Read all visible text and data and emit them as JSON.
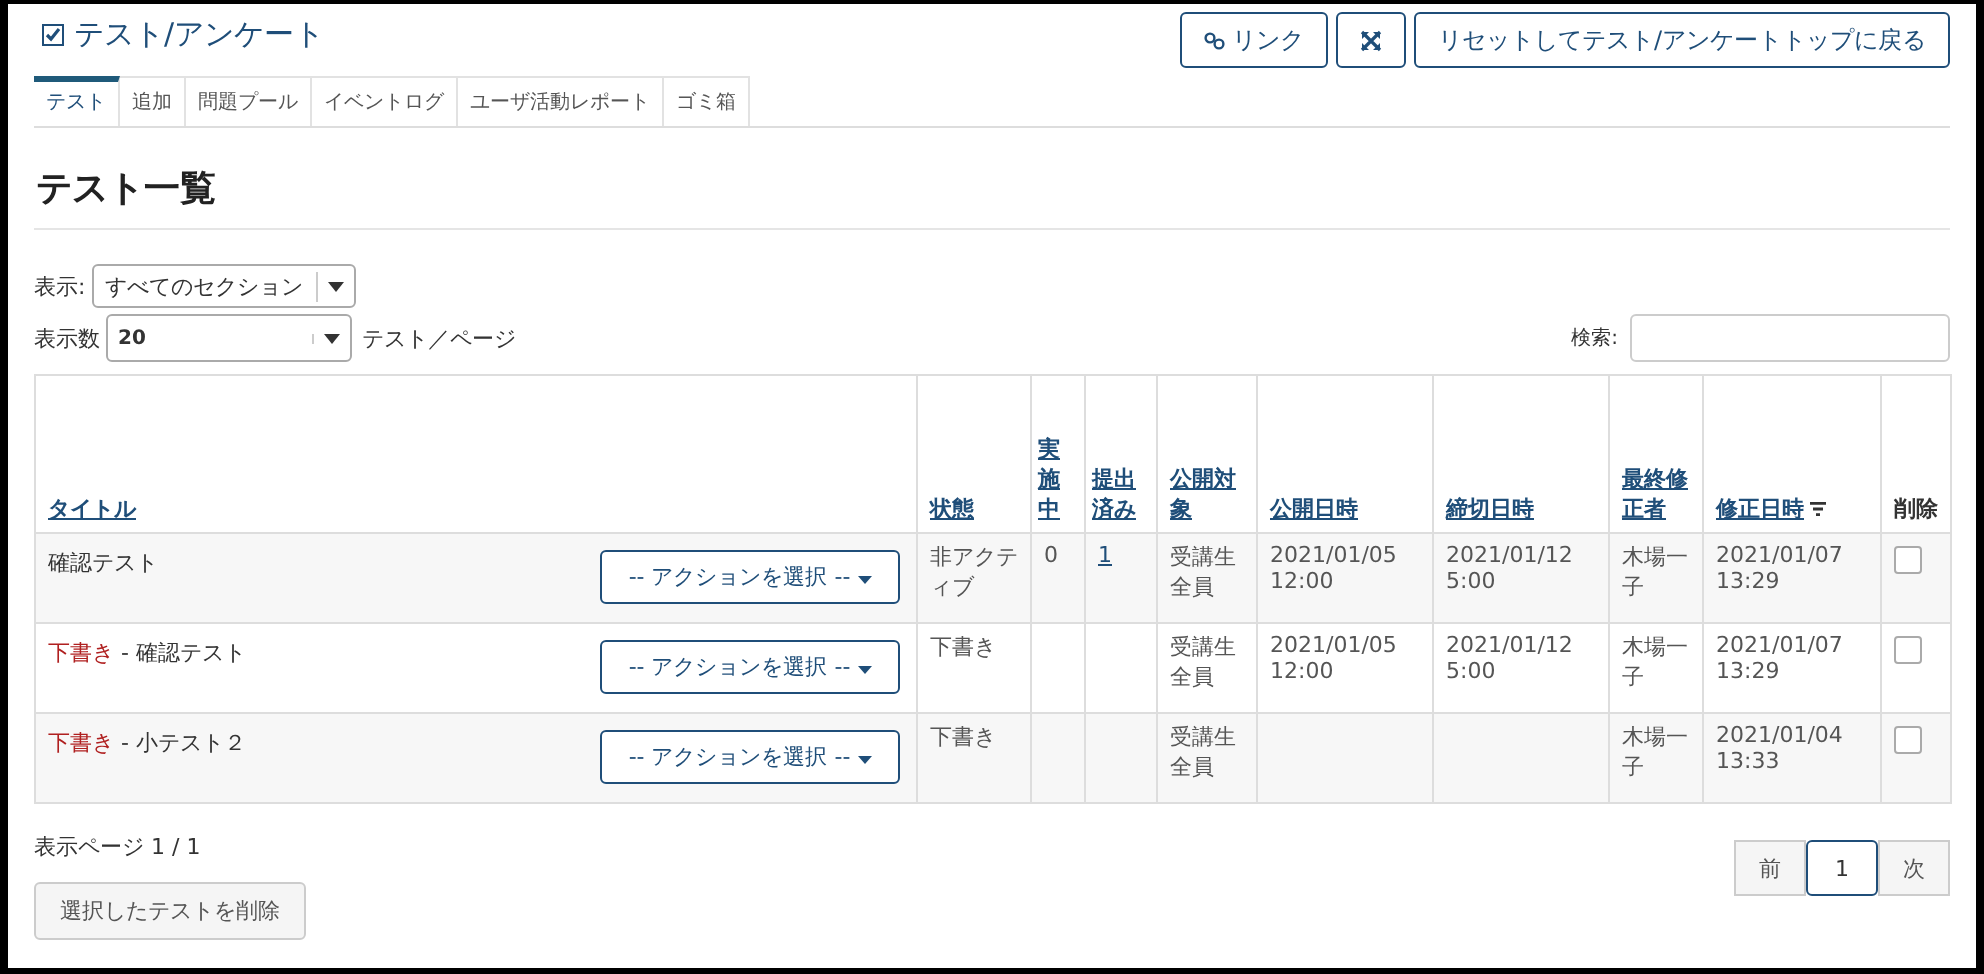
{
  "header": {
    "title": "テスト/アンケート",
    "buttons": [
      {
        "kind": "link",
        "label": "リンク"
      },
      {
        "kind": "expand"
      },
      {
        "kind": "text",
        "label": "リセットしてテスト/アンケートトップに戻る"
      }
    ]
  },
  "tabs": [
    {
      "label": "テスト",
      "selected": true
    },
    {
      "label": "追加",
      "selected": false
    },
    {
      "label": "問題プール",
      "selected": false
    },
    {
      "label": "イベントログ",
      "selected": false
    },
    {
      "label": "ユーザ活動レポート",
      "selected": false
    },
    {
      "label": "ゴミ箱",
      "selected": false
    }
  ],
  "heading": "テスト一覧",
  "filters": {
    "section_label": "表示:",
    "section_value": "すべてのセクション",
    "per_page_label": "表示数",
    "per_page_value": "20",
    "per_page_suffix": "テスト／ページ",
    "search_label": "検索:"
  },
  "table": {
    "columns": [
      {
        "label": "タイトル",
        "link": true,
        "sorted": false
      },
      {
        "label": "状態",
        "link": true,
        "sorted": false
      },
      {
        "label": "実施中",
        "link": true,
        "sorted": false
      },
      {
        "label": "提出済み",
        "link": true,
        "sorted": false
      },
      {
        "label": "公開対象",
        "link": true,
        "sorted": false
      },
      {
        "label": "公開日時",
        "link": true,
        "sorted": false
      },
      {
        "label": "締切日時",
        "link": true,
        "sorted": false
      },
      {
        "label": "最終修正者",
        "link": true,
        "sorted": false
      },
      {
        "label": "修正日時",
        "link": true,
        "sorted": true
      },
      {
        "label": "削除",
        "link": false,
        "sorted": false
      }
    ],
    "rows": [
      {
        "title": "確認テスト",
        "action": "-- アクションを選択 --",
        "status": "非アクティブ",
        "in_progress": "0",
        "submitted": "1",
        "audience": "受講生全員",
        "open_date": "2021/01/05 12:00",
        "due_date": "2021/01/12 5:00",
        "modified_by": "木場一子",
        "modified": "2021/01/07 13:29",
        "checked": false
      },
      {
        "tag": "下書き",
        "title": "- 確認テスト",
        "action": "-- アクションを選択 --",
        "status": "下書き",
        "audience": "受講生全員",
        "open_date": "2021/01/05 12:00",
        "due_date": "2021/01/12 5:00",
        "modified_by": "木場一子",
        "modified": "2021/01/07 13:29",
        "checked": false
      },
      {
        "tag": "下書き",
        "title": "- 小テスト２",
        "action": "-- アクションを選択 --",
        "status": "下書き",
        "audience": "受講生全員",
        "modified_by": "木場一子",
        "modified": "2021/01/04 13:33",
        "checked": false
      }
    ]
  },
  "footer": {
    "page_info": "表示ページ 1 / 1",
    "pagination": [
      {
        "label": "前",
        "selected": false
      },
      {
        "label": "1",
        "selected": true
      },
      {
        "label": "次",
        "selected": false
      }
    ],
    "delete_button": "選択したテストを削除"
  }
}
